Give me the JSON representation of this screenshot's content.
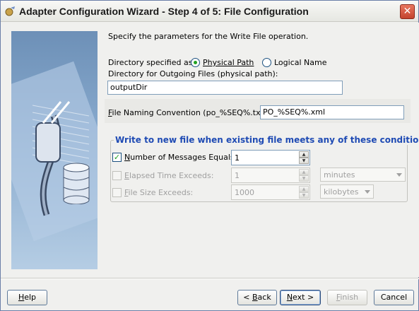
{
  "window": {
    "title": "Adapter Configuration Wizard - Step 4 of 5: File Configuration",
    "close_label": "✕"
  },
  "main": {
    "intro": "Specify the parameters for the Write File operation.",
    "directory_specified_as_label": "Directory specified as",
    "radio_physical_label": "Physical Path",
    "radio_logical_label": "Logical Name",
    "selected_directory_type": "Physical Path",
    "outgoing_dir_label": "Directory for Outgoing Files (physical path):",
    "outgoing_dir_value": "outputDir",
    "file_naming_label_accel": "F",
    "file_naming_label_rest": "ile Naming Convention (po_%SEQ%.txt):",
    "file_naming_value": "PO_%SEQ%.xml"
  },
  "conditions": {
    "group_title": "Write to new file when existing file meets any of these conditions",
    "num_messages": {
      "checked": true,
      "label_accel": "N",
      "label_rest": "umber of Messages Equals:",
      "value": "1"
    },
    "elapsed_time": {
      "checked": false,
      "label_accel": "E",
      "label_rest": "lapsed Time Exceeds:",
      "value": "1",
      "unit": "minutes"
    },
    "file_size": {
      "checked": false,
      "label_accel": "F",
      "label_rest": "ile Size Exceeds:",
      "value": "1000",
      "unit": "kilobytes"
    }
  },
  "footer": {
    "help_accel": "H",
    "help_rest": "elp",
    "back_lt": "< ",
    "back_accel": "B",
    "back_rest": "ack",
    "next_accel": "N",
    "next_rest": "ext >",
    "finish_accel": "F",
    "finish_rest": "inish",
    "cancel_label": "Cancel"
  },
  "colors": {
    "group_title": "#1f4bb4",
    "check_mark": "#21a121",
    "side_image_top": "#6d90b7"
  },
  "icons": [
    "wizard-app-icon",
    "close-icon",
    "plug-cable-icon",
    "database-icon"
  ]
}
